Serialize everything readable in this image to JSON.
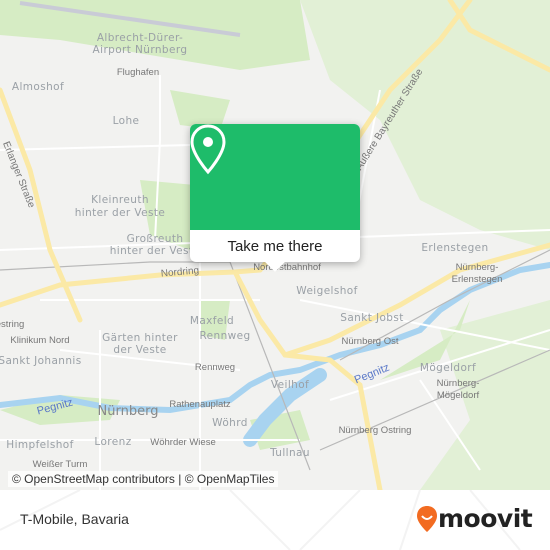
{
  "map": {
    "labels": [
      {
        "text": "Albrecht-Dürer-",
        "type": "district"
      },
      {
        "text": "Airport Nürnberg",
        "type": "district"
      },
      {
        "text": "Flughafen",
        "type": "station"
      },
      {
        "text": "Almoshof",
        "type": "district"
      },
      {
        "text": "Lohe",
        "type": "district"
      },
      {
        "text": "Kleinreuth",
        "type": "district"
      },
      {
        "text": "hinter der Veste",
        "type": "district"
      },
      {
        "text": "Großreuth",
        "type": "district"
      },
      {
        "text": "hinter der Veste",
        "type": "district"
      },
      {
        "text": "Nordring",
        "type": "road"
      },
      {
        "text": "Nordostbahnhof",
        "type": "station"
      },
      {
        "text": "Weigelshof",
        "type": "district"
      },
      {
        "text": "Erlenstegen",
        "type": "district"
      },
      {
        "text": "Nürnberg-",
        "type": "station"
      },
      {
        "text": "Erlenstegen",
        "type": "station"
      },
      {
        "text": "Sankt Jobst",
        "type": "district"
      },
      {
        "text": "Nürnberg Ost",
        "type": "station"
      },
      {
        "text": "Maxfeld",
        "type": "district"
      },
      {
        "text": "Rennweg",
        "type": "district"
      },
      {
        "text": "Rennweg",
        "type": "station"
      },
      {
        "text": "Veilhof",
        "type": "district"
      },
      {
        "text": "Mögeldorf",
        "type": "district"
      },
      {
        "text": "Nürnberg-",
        "type": "station"
      },
      {
        "text": "Mögeldorf",
        "type": "station"
      },
      {
        "text": "Pegnitz",
        "type": "water"
      },
      {
        "text": "Pegnitz",
        "type": "water"
      },
      {
        "text": "Nürnberg",
        "type": "city"
      },
      {
        "text": "Rathenauplatz",
        "type": "station"
      },
      {
        "text": "Wöhrd",
        "type": "district"
      },
      {
        "text": "Nürnberg Ostring",
        "type": "station"
      },
      {
        "text": "Tullnau",
        "type": "district"
      },
      {
        "text": "Gärten hinter",
        "type": "district"
      },
      {
        "text": "der Veste",
        "type": "district"
      },
      {
        "text": "Klinikum Nord",
        "type": "station"
      },
      {
        "text": "Sankt Johannis",
        "type": "district"
      },
      {
        "text": "Himpfelshof",
        "type": "district"
      },
      {
        "text": "Lorenz",
        "type": "district"
      },
      {
        "text": "Wöhrder Wiese",
        "type": "station"
      },
      {
        "text": "Weißer Turm",
        "type": "station"
      },
      {
        "text": "Erlanger Straße",
        "type": "road"
      },
      {
        "text": "Äußere Bayreuther Straße",
        "type": "road"
      },
      {
        "text": "estring",
        "type": "station"
      }
    ],
    "popup": {
      "button_label": "Take me there",
      "icon": "map-pin-icon",
      "color": "#1ebc6a"
    },
    "attribution": "© OpenStreetMap contributors | © OpenMapTiles"
  },
  "footer": {
    "title": "T-Mobile, Bavaria",
    "brand": "moovit",
    "brand_color": "#f26b21"
  }
}
